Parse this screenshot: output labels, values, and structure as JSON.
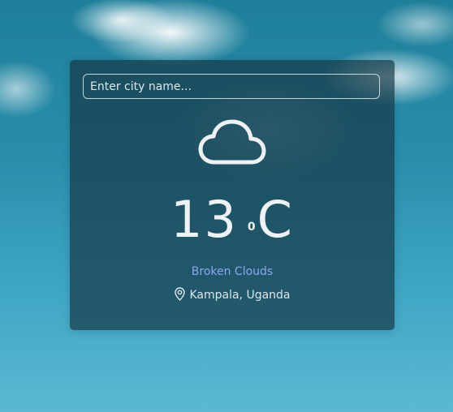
{
  "search": {
    "placeholder": "Enter city name..."
  },
  "weather": {
    "icon": "cloud-icon",
    "temperature": "13",
    "degree_symbol": "0",
    "unit": "C",
    "description": "Broken Clouds",
    "location": "Kampala, Uganda"
  },
  "colors": {
    "card_background": "#163a48",
    "description_text": "#8aa6f0",
    "primary_text": "#eef2f4"
  }
}
